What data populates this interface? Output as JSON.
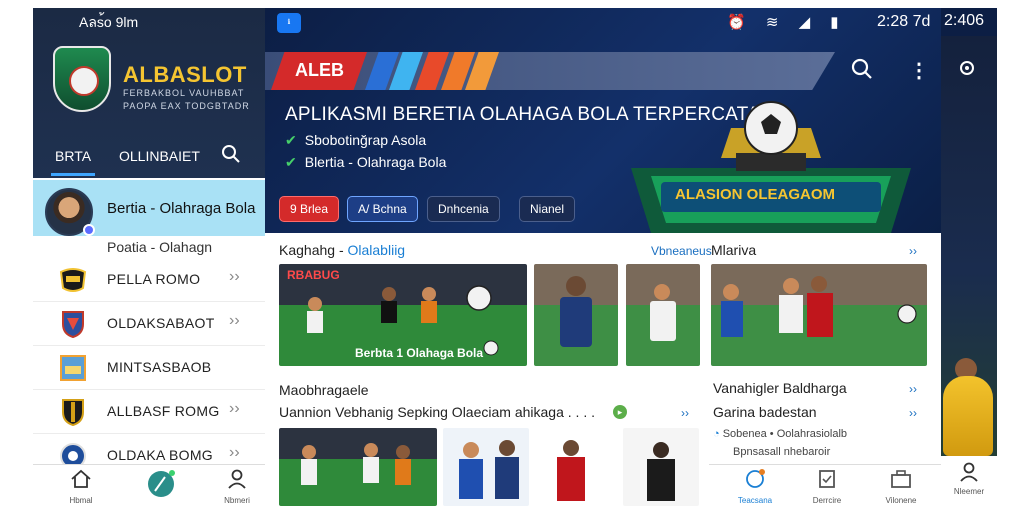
{
  "left_panel": {
    "status_text": "Aลs้o 9lm",
    "brand": "ALBASLOT",
    "brand_sub1": "FERBAKBOL VAUHBBAT",
    "brand_sub2": "PAOPA EAX TODGBTADR",
    "tabs": [
      "BRTA",
      "OLLINBAIET"
    ],
    "highlight_item": "Bertia - Olahraga Bola",
    "sub_label": "Poatia - Olahagn",
    "items": [
      {
        "label": "PELLA ROMO",
        "icon": "ball-badge-icon"
      },
      {
        "label": "OLDAKSABAOT",
        "icon": "shield-badge-icon"
      },
      {
        "label": "MINTSASBAOB",
        "icon": "stadium-badge-icon"
      },
      {
        "label": "ALLBASF ROMG",
        "icon": "crest-badge-icon"
      },
      {
        "label": "OLDAKA BOMG",
        "icon": "globe-badge-icon"
      }
    ],
    "nav": [
      "Hbmal",
      "",
      "Nbmeri"
    ]
  },
  "main": {
    "status_time": "2:28 7d",
    "banner_text": "ALEB",
    "hero_title": "APLIKASMI BERETIA OLAHAGA BOLA TERPERCATA",
    "checks": [
      "Sbobotinğrap Asola",
      "Blertia - Olahraga Bola"
    ],
    "trophy_label": "ALASION OLEAGAOM",
    "chips": [
      "9 Brlea",
      "A/ Bchna",
      "Dnhcenia",
      "Nianel"
    ],
    "section1_title_a": "Kaghahg - ",
    "section1_title_b": "Olalabliig",
    "section1_more": "Vbneaneus",
    "section1_right_title": "Mlariva",
    "thumb_caption": "Berbta 1 Olahaga Bola",
    "thumb_red_label": "RBABUG",
    "section2_title": "Maobhragaele",
    "section2_subtitle": "Uannion Vebhanig Sepking Olaeciam ahikaga . . . .",
    "section2_right_title": "Vanahigler Baldharga",
    "section2_right_sub": "Garina badestan",
    "section2_right_line1": "Sobenea • Oolahrasiolalb",
    "section2_right_line2": "Bpnsasall nhebaroir",
    "right_nav": [
      "Teacsana",
      "Derrcire",
      "Vilonene"
    ]
  },
  "right_strip": {
    "time": "2:406",
    "nav_label": "Nleemer"
  },
  "colors": {
    "accent_blue": "#1a7fd4",
    "brand_gold": "#f5c531",
    "hero_navy": "#0c1e44",
    "chip_red": "#d42a2a",
    "highlight_bg": "#a9e1f5"
  }
}
